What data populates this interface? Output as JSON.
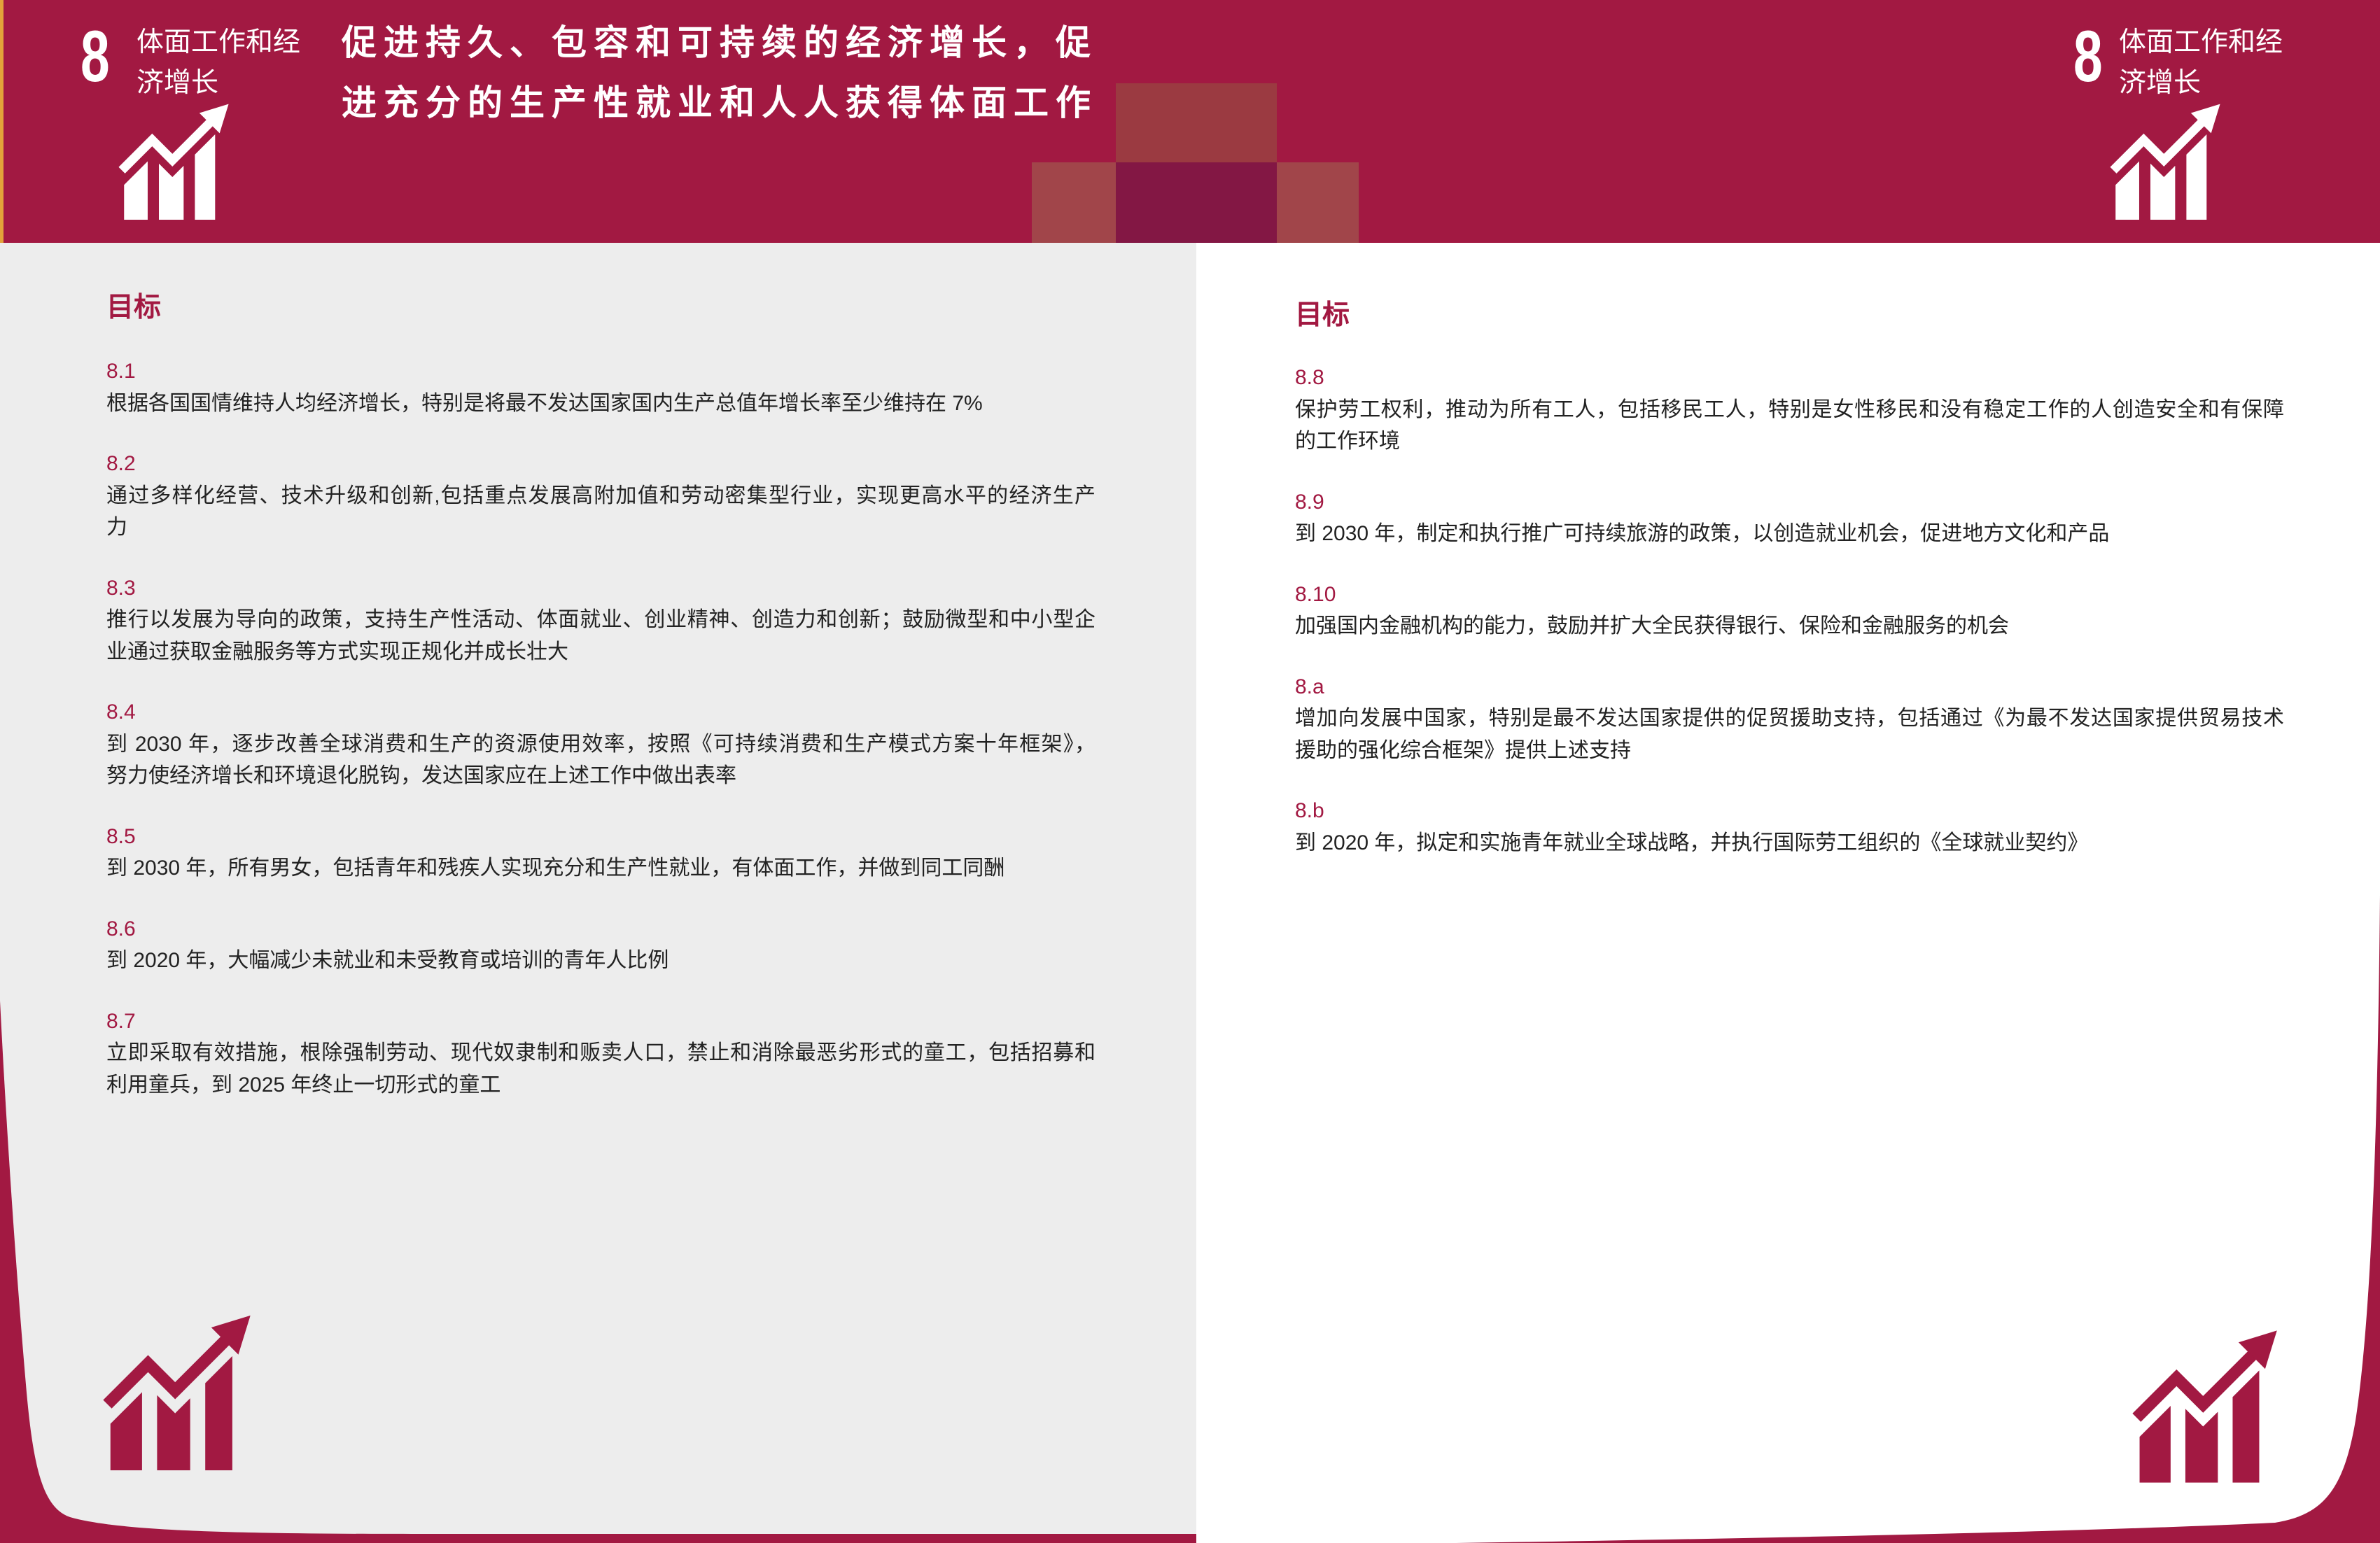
{
  "colors": {
    "brand_red": "#A21942",
    "left_page_bg": "#EDEDED",
    "right_page_bg": "#FFFFFF",
    "text": "#222222"
  },
  "icons": {
    "goal_icon": "growth-chart-icon"
  },
  "header": {
    "left_badge": {
      "number": "8",
      "name_lines": [
        "体面工作和经",
        "济增长"
      ]
    },
    "title_lines": [
      "促进持久、包容和可持续的经济增长，促",
      "进充分的生产性就业和人人获得体面工作"
    ],
    "right_badge": {
      "number": "8",
      "name_lines": [
        "体面工作和经",
        "济增长"
      ]
    }
  },
  "left_page": {
    "heading": "目标",
    "targets": [
      {
        "id": "8.1",
        "lines": [
          "根据各国国情维持人均经济增长，特别是将最不发达国家国内生产总值年增长率至少维持在 7%"
        ]
      },
      {
        "id": "8.2",
        "lines": [
          "通过多样化经营、技术升级和创新,包括重点发展高附加值和劳动密集型行业，实现更高水平的经济生产",
          "力"
        ]
      },
      {
        "id": "8.3",
        "lines": [
          "推行以发展为导向的政策，支持生产性活动、体面就业、创业精神、创造力和创新；鼓励微型和中小型企",
          "业通过获取金融服务等方式实现正规化并成长壮大"
        ]
      },
      {
        "id": "8.4",
        "lines": [
          "到 2030 年，逐步改善全球消费和生产的资源使用效率，按照《可持续消费和生产模式方案十年框架》，",
          "努力使经济增长和环境退化脱钩，发达国家应在上述工作中做出表率"
        ]
      },
      {
        "id": "8.5",
        "lines": [
          "到 2030 年，所有男女，包括青年和残疾人实现充分和生产性就业，有体面工作，并做到同工同酬"
        ]
      },
      {
        "id": "8.6",
        "lines": [
          "到 2020 年，大幅减少未就业和未受教育或培训的青年人比例"
        ]
      },
      {
        "id": "8.7",
        "lines": [
          "立即采取有效措施，根除强制劳动、现代奴隶制和贩卖人口，禁止和消除最恶劣形式的童工，包括招募和",
          "利用童兵，到 2025 年终止一切形式的童工"
        ]
      }
    ]
  },
  "right_page": {
    "heading": "目标",
    "targets": [
      {
        "id": "8.8",
        "lines": [
          "保护劳工权利，推动为所有工人，包括移民工人，特别是女性移民和没有稳定工作的人创造安全和有保障",
          "的工作环境"
        ]
      },
      {
        "id": "8.9",
        "lines": [
          "到 2030 年，制定和执行推广可持续旅游的政策，以创造就业机会，促进地方文化和产品"
        ]
      },
      {
        "id": "8.10",
        "lines": [
          "加强国内金融机构的能力，鼓励并扩大全民获得银行、保险和金融服务的机会"
        ]
      },
      {
        "id": "8.a",
        "lines": [
          "增加向发展中国家，特别是最不发达国家提供的促贸援助支持，包括通过《为最不发达国家提供贸易技术",
          "援助的强化综合框架》提供上述支持"
        ]
      },
      {
        "id": "8.b",
        "lines": [
          "到 2020 年，拟定和实施青年就业全球战略，并执行国际劳工组织的《全球就业契约》"
        ]
      }
    ]
  }
}
